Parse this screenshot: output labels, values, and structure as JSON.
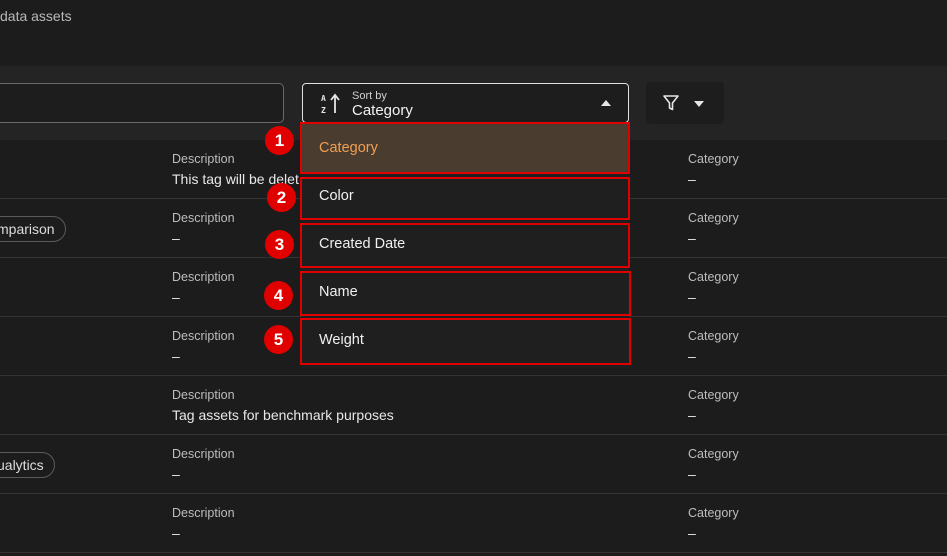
{
  "header": {
    "text": "data assets"
  },
  "toolbar": {
    "search_value": "",
    "sort": {
      "small_label": "Sort by",
      "value": "Category"
    }
  },
  "rows": [
    {
      "tag": "",
      "description_label": "Description",
      "description": "This tag will be delet",
      "category_label": "Category",
      "category": "–"
    },
    {
      "tag": "mparison",
      "description_label": "Description",
      "description": "–",
      "category_label": "Category",
      "category": "–"
    },
    {
      "tag": "",
      "description_label": "Description",
      "description": "–",
      "category_label": "Category",
      "category": "–"
    },
    {
      "tag": "",
      "description_label": "Description",
      "description": "–",
      "category_label": "Category",
      "category": "–"
    },
    {
      "tag": "",
      "description_label": "Description",
      "description": "Tag assets for benchmark purposes",
      "category_label": "Category",
      "category": "–"
    },
    {
      "tag": "ualytics",
      "description_label": "Description",
      "description": "–",
      "category_label": "Category",
      "category": "–"
    },
    {
      "tag": "",
      "description_label": "Description",
      "description": "–",
      "category_label": "Category",
      "category": "–"
    }
  ],
  "dropdown": {
    "options": [
      {
        "label": "Category",
        "badge": "1"
      },
      {
        "label": "Color",
        "badge": "2"
      },
      {
        "label": "Created Date",
        "badge": "3"
      },
      {
        "label": "Name",
        "badge": "4"
      },
      {
        "label": "Weight",
        "badge": "5"
      }
    ]
  },
  "colors": {
    "accent": "#f0a050",
    "highlight": "#e00000"
  },
  "icons": {
    "sort": "sort-az-icon",
    "filter": "filter-icon",
    "sort_caret": "caret-up-icon",
    "filter_caret": "caret-down-icon"
  }
}
